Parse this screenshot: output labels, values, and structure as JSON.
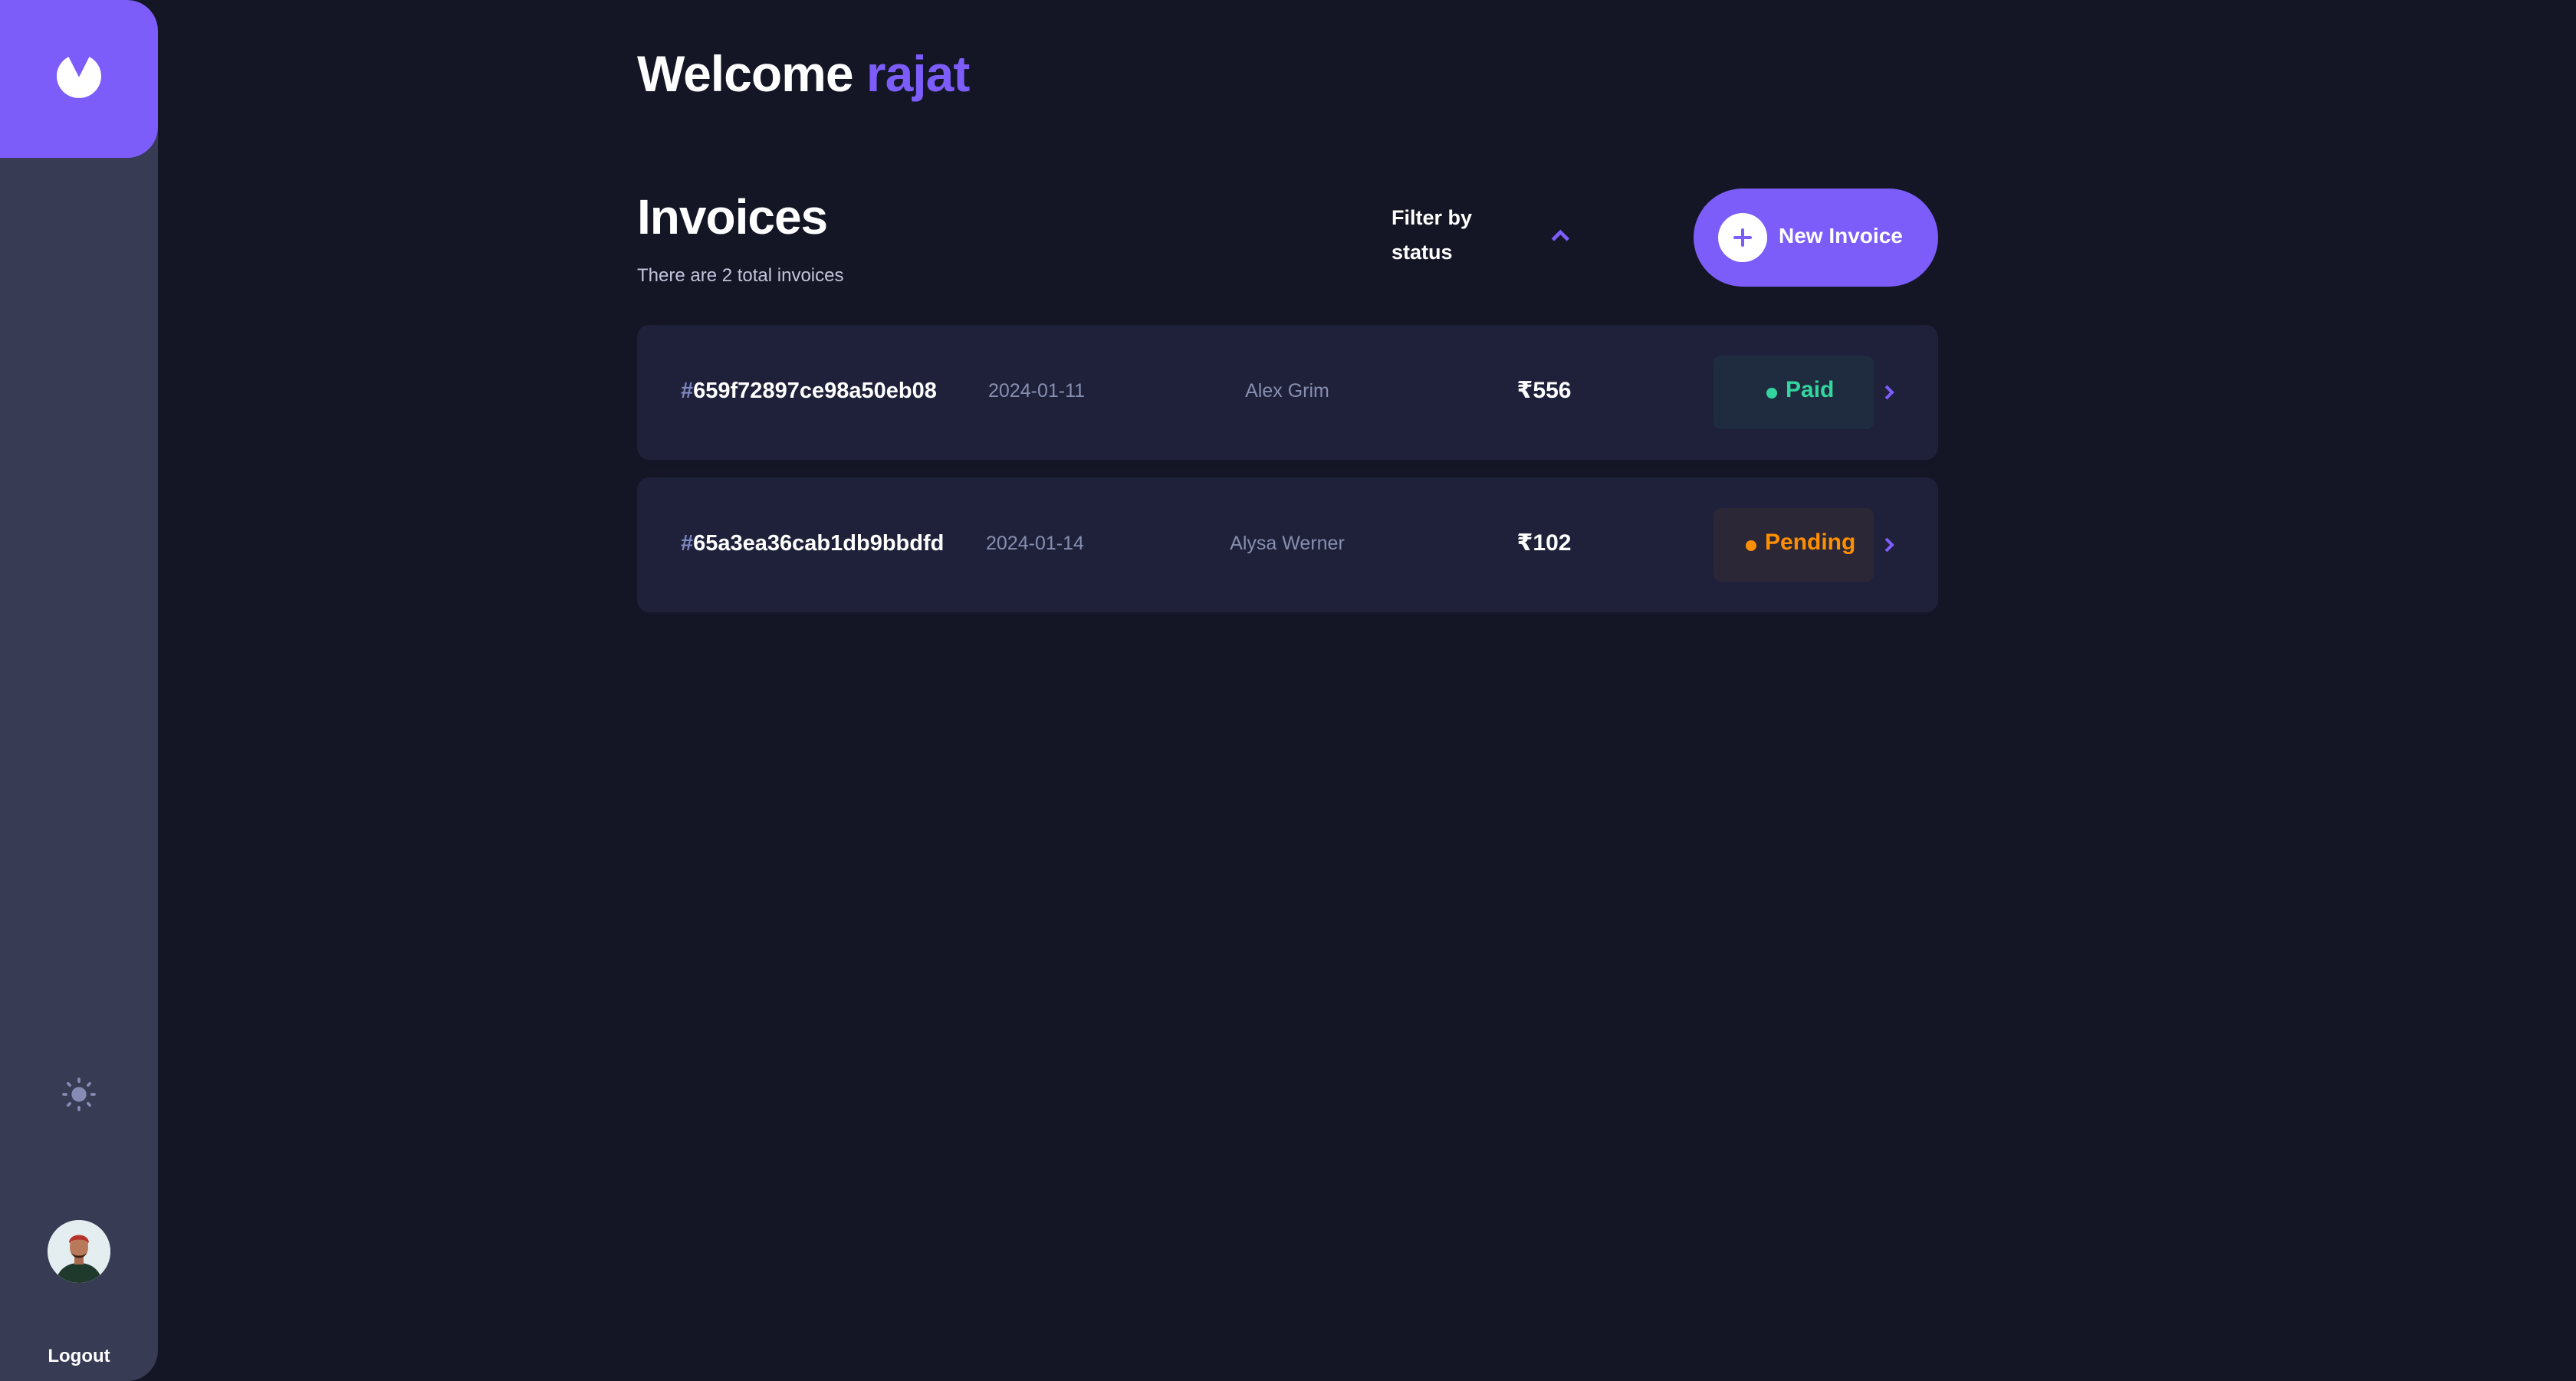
{
  "sidebar": {
    "logo_icon": "app-logo-icon",
    "theme_icon": "sun-icon",
    "avatar": "user-avatar",
    "logout_label": "Logout"
  },
  "header": {
    "welcome_prefix": "Welcome",
    "user_name": "rajat"
  },
  "invoices": {
    "title": "Invoices",
    "subtitle": "There are 2 total invoices",
    "filter_label": "Filter by status",
    "filter_icon": "chevron-up-icon",
    "new_button_label": "New Invoice",
    "new_button_icon": "plus-icon",
    "rows": [
      {
        "hash": "#",
        "id": "659f72897ce98a50eb08",
        "date": "2024-01-11",
        "client": "Alex Grim",
        "amount": "₹556",
        "status": "Paid"
      },
      {
        "hash": "#",
        "id": "65a3ea36cab1db9bbdfd",
        "date": "2024-01-14",
        "client": "Alysa Werner",
        "amount": "₹102",
        "status": "Pending"
      }
    ]
  },
  "colors": {
    "background": "#141625",
    "sidebar": "#373b53",
    "accent": "#7c5dfa",
    "card": "#1e2139",
    "paid": "#33d69f",
    "pending": "#ff8f00"
  }
}
